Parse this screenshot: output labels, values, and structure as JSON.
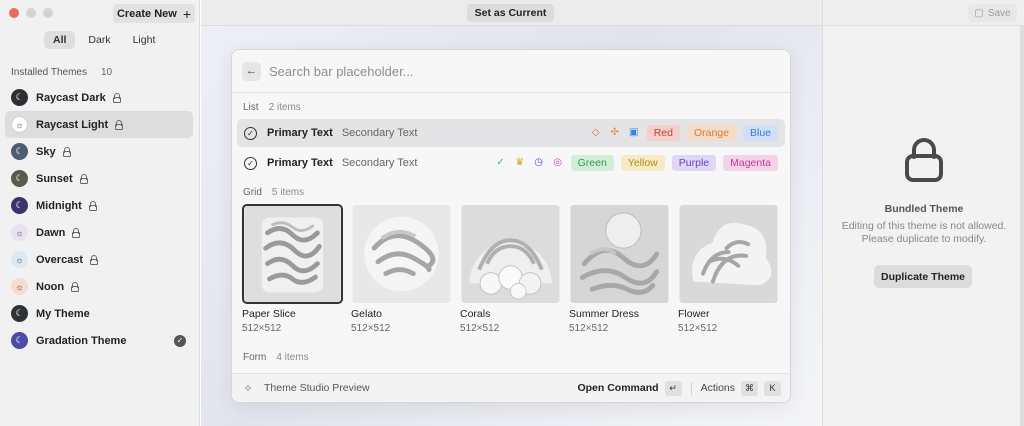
{
  "sidebar": {
    "create_new_label": "Create New",
    "filters": [
      "All",
      "Dark",
      "Light"
    ],
    "section_title": "Installed Themes",
    "section_count": "10",
    "themes": [
      {
        "name": "Raycast Dark",
        "icon": "moon-icon",
        "color": "#2d2f35",
        "glyph": "☾",
        "locked": true
      },
      {
        "name": "Raycast Light",
        "icon": "sun-icon",
        "color": "#ffffff",
        "glyph": "☼",
        "locked": true,
        "selected": true
      },
      {
        "name": "Sky",
        "icon": "moon-icon",
        "color": "#4c5d74",
        "glyph": "☾",
        "locked": true
      },
      {
        "name": "Sunset",
        "icon": "moon-icon",
        "color": "#5c5a4c",
        "glyph": "☾",
        "locked": true
      },
      {
        "name": "Midnight",
        "icon": "moon-icon",
        "color": "#3c356b",
        "glyph": "☾",
        "locked": true
      },
      {
        "name": "Dawn",
        "icon": "sun-icon",
        "color": "#e9e0f2",
        "glyph": "☼",
        "locked": true
      },
      {
        "name": "Overcast",
        "icon": "sun-icon",
        "color": "#dce8f2",
        "glyph": "☼",
        "locked": true
      },
      {
        "name": "Noon",
        "icon": "sun-icon",
        "color": "#f6dccf",
        "glyph": "☼",
        "locked": true
      },
      {
        "name": "My Theme",
        "icon": "moon-icon",
        "color": "#2f3236",
        "glyph": "☾",
        "locked": false
      },
      {
        "name": "Gradation Theme",
        "icon": "moon-icon",
        "color": "#4d4aa8",
        "glyph": "☾",
        "locked": false,
        "checked": true
      }
    ]
  },
  "center": {
    "set_current_label": "Set as Current",
    "search_placeholder": "Search bar placeholder...",
    "list_section": {
      "label": "List",
      "count": "2 items"
    },
    "list_rows": [
      {
        "primary": "Primary Text",
        "secondary": "Secondary Text",
        "selected": true,
        "icons": [
          {
            "name": "tag-icon",
            "glyph": "◇",
            "color": "#e0583f"
          },
          {
            "name": "puzzle-icon",
            "glyph": "✣",
            "color": "#e88a3c"
          },
          {
            "name": "calendar-icon",
            "glyph": "▣",
            "color": "#3b82e6"
          }
        ],
        "tags": [
          {
            "label": "Red",
            "color": "#c8402f",
            "bg": "#f3cfca"
          },
          {
            "label": "Orange",
            "color": "#d27a3b",
            "bg": "#f5dcc7"
          },
          {
            "label": "Blue",
            "color": "#3a78d4",
            "bg": "#d2e0f5"
          }
        ]
      },
      {
        "primary": "Primary Text",
        "secondary": "Secondary Text",
        "selected": false,
        "icons": [
          {
            "name": "check-circle-icon",
            "glyph": "✓",
            "color": "#3bb35a"
          },
          {
            "name": "crown-icon",
            "glyph": "♛",
            "color": "#d6a41e"
          },
          {
            "name": "clock-icon",
            "glyph": "◷",
            "color": "#6a3fd1"
          },
          {
            "name": "fingerprint-icon",
            "glyph": "◎",
            "color": "#d23f9f"
          }
        ],
        "tags": [
          {
            "label": "Green",
            "color": "#2f9a4c",
            "bg": "#d2eed9"
          },
          {
            "label": "Yellow",
            "color": "#b78d18",
            "bg": "#f5ebc6"
          },
          {
            "label": "Purple",
            "color": "#6a3fd1",
            "bg": "#e0d6f6"
          },
          {
            "label": "Magenta",
            "color": "#c93796",
            "bg": "#f4d3e9"
          }
        ]
      }
    ],
    "grid_section": {
      "label": "Grid",
      "count": "5 items"
    },
    "grid_items": [
      {
        "title": "Paper Slice",
        "subtitle": "512×512",
        "selected": true
      },
      {
        "title": "Gelato",
        "subtitle": "512×512"
      },
      {
        "title": "Corals",
        "subtitle": "512×512"
      },
      {
        "title": "Summer Dress",
        "subtitle": "512×512"
      },
      {
        "title": "Flower",
        "subtitle": "512×512"
      }
    ],
    "form_section": {
      "label": "Form",
      "count": "4 items"
    },
    "footer": {
      "title": "Theme Studio Preview",
      "primary_action": "Open Command",
      "primary_key": "↵",
      "actions_label": "Actions",
      "actions_keys": [
        "⌘",
        "K"
      ]
    }
  },
  "right": {
    "save_label": "Save",
    "bundled_title": "Bundled Theme",
    "bundled_description": "Editing of this theme is not allowed. Please duplicate to modify.",
    "duplicate_label": "Duplicate Theme"
  }
}
